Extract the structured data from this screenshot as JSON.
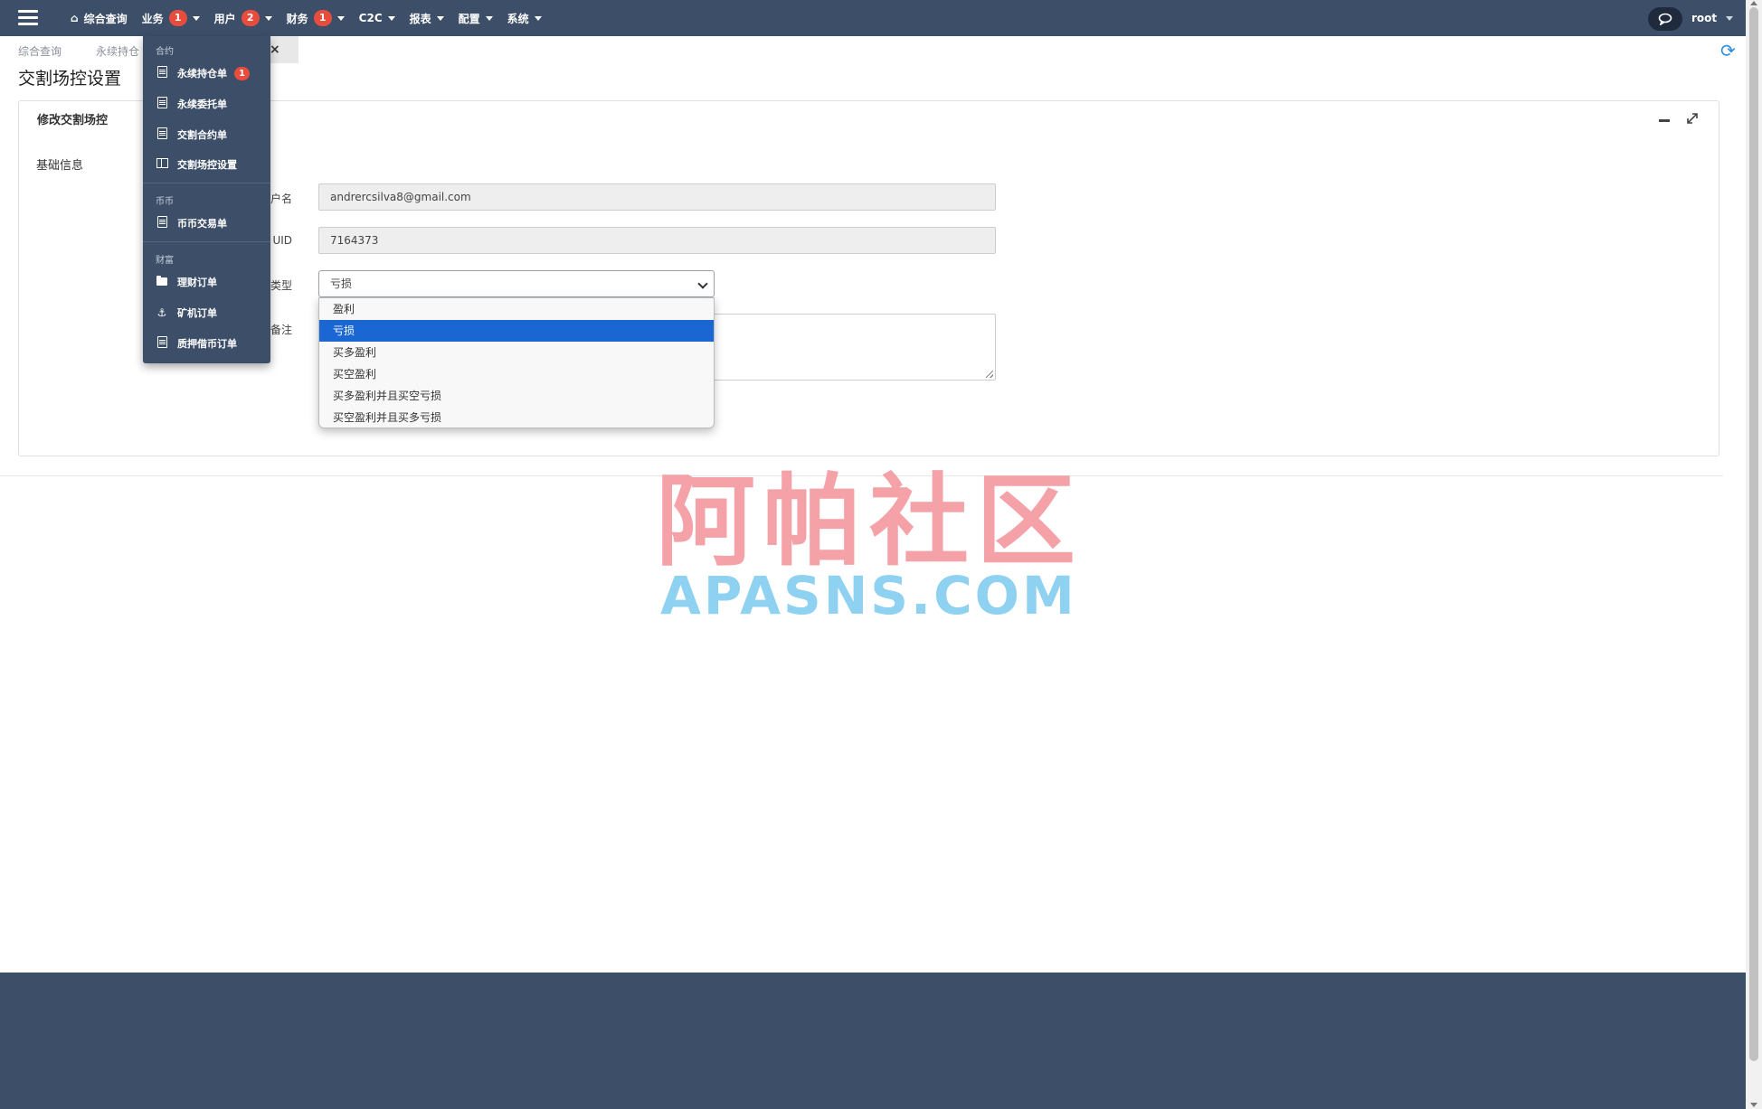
{
  "nav": {
    "items": [
      {
        "label": "综合查询"
      },
      {
        "label": "业务",
        "badge": "1"
      },
      {
        "label": "用户",
        "badge": "2"
      },
      {
        "label": "财务",
        "badge": "1"
      },
      {
        "label": "C2C"
      },
      {
        "label": "报表"
      },
      {
        "label": "配置"
      },
      {
        "label": "系统"
      }
    ],
    "user": "root"
  },
  "breadcrumb": [
    "综合查询",
    "永续持仓"
  ],
  "page_title": "交割场控设置",
  "panel": {
    "title": "修改交割场控",
    "section": "基础信息",
    "fields": {
      "username_label": "户名",
      "username_value": "andrercsilva8@gmail.com",
      "uid_label": "UID",
      "uid_value": "7164373",
      "type_label": "类型",
      "type_value": "亏损",
      "remark_label": "备注"
    },
    "type_options": [
      "盈利",
      "亏损",
      "买多盈利",
      "买空盈利",
      "买多盈利并且买空亏损",
      "买空盈利并且买多亏损"
    ],
    "selected_option": "亏损"
  },
  "business_menu": {
    "groups": [
      {
        "header": "合约",
        "items": [
          {
            "label": "永续持仓单",
            "icon": "document-icon",
            "badge": "1"
          },
          {
            "label": "永续委托单",
            "icon": "document-icon"
          },
          {
            "label": "交割合约单",
            "icon": "document-icon"
          },
          {
            "label": "交割场控设置",
            "icon": "columns-icon"
          }
        ]
      },
      {
        "header": "币币",
        "items": [
          {
            "label": "币币交易单",
            "icon": "document-icon"
          }
        ]
      },
      {
        "header": "财富",
        "items": [
          {
            "label": "理财订单",
            "icon": "folder-icon"
          },
          {
            "label": "矿机订单",
            "icon": "anchor-icon"
          },
          {
            "label": "质押借币订单",
            "icon": "document-icon"
          }
        ]
      }
    ]
  },
  "watermark": {
    "cn": "阿帕社区",
    "en": "APASNS.COM"
  },
  "colors": {
    "nav_bg": "#3d4e68",
    "badge": "#e74c3c",
    "selected_option": "#1a66d2",
    "refresh": "#2e8de0"
  }
}
